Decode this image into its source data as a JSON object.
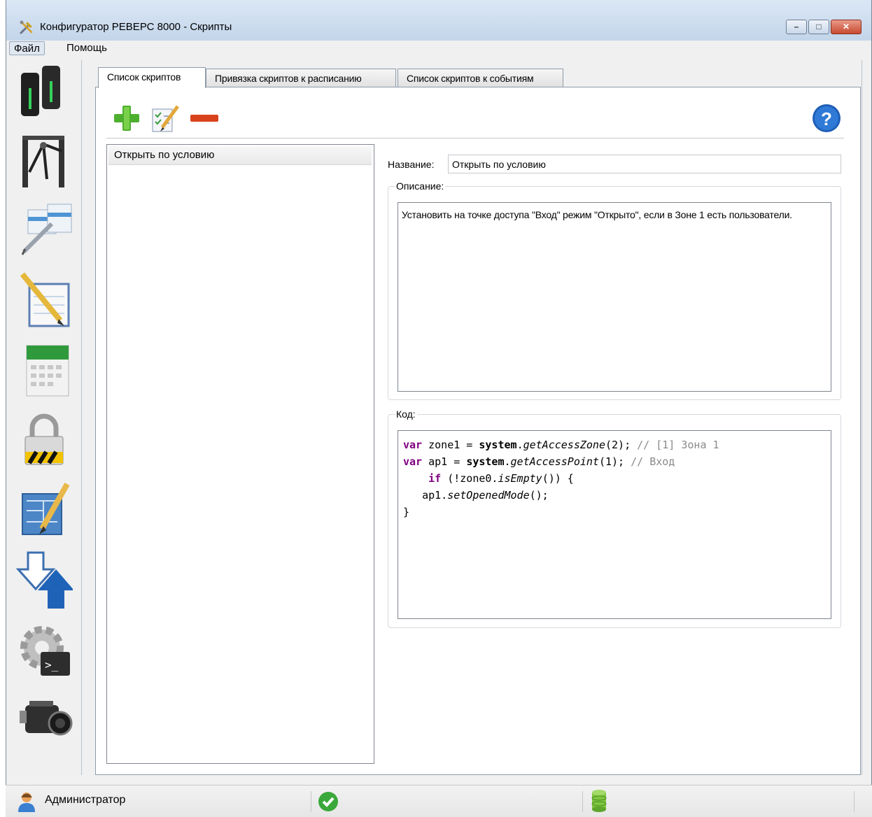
{
  "window": {
    "title": "Конфигуратор РЕВЕРС 8000 - Скрипты",
    "controls": {
      "minimize": "–",
      "maximize": "□",
      "close": "✕"
    }
  },
  "menu": {
    "items": [
      "Файл",
      "Помощь"
    ]
  },
  "sidebar": {
    "items": [
      "card-readers-icon",
      "turnstile-icon",
      "access-levels-icon",
      "notepad-icon",
      "calendar-icon",
      "padlock-icon",
      "map-editor-icon",
      "upload-download-icon",
      "script-gear-icon",
      "video-camera-icon"
    ]
  },
  "tabs": [
    "Список скриптов",
    "Привязка скриптов к расписанию",
    "Список скриптов к событиям"
  ],
  "toolbar": {
    "add": "plus-icon",
    "edit": "edit-checklist-icon",
    "remove": "minus-icon",
    "help": "?"
  },
  "scripts": {
    "items": [
      "Открыть по условию"
    ]
  },
  "form": {
    "name_label": "Название:",
    "name_value": "Открыть по условию",
    "description_label": "Описание:",
    "description_text": "Установить на точке доступа \"Вход\" режим \"Открыто\", если в Зоне 1 есть пользователи.",
    "code_label": "Код:"
  },
  "code": {
    "lines": [
      [
        {
          "t": "var",
          "c": "kw"
        },
        {
          "t": " zone1 = ",
          "c": ""
        },
        {
          "t": "system",
          "c": "sys"
        },
        {
          "t": ".",
          "c": ""
        },
        {
          "t": "getAccessZone",
          "c": "it"
        },
        {
          "t": "(2); ",
          "c": ""
        },
        {
          "t": "// [1] Зона 1",
          "c": "cm"
        }
      ],
      [
        {
          "t": "var",
          "c": "kw"
        },
        {
          "t": " ap1 = ",
          "c": ""
        },
        {
          "t": "system",
          "c": "sys"
        },
        {
          "t": ".",
          "c": ""
        },
        {
          "t": "getAccessPoint",
          "c": "it"
        },
        {
          "t": "(1); ",
          "c": ""
        },
        {
          "t": "// Вход",
          "c": "cm"
        }
      ],
      [
        {
          "t": "    ",
          "c": ""
        },
        {
          "t": "if",
          "c": "kw"
        },
        {
          "t": " (!zone0.",
          "c": ""
        },
        {
          "t": "isEmpty",
          "c": "it"
        },
        {
          "t": "()) {",
          "c": ""
        }
      ],
      [
        {
          "t": "   ap1.",
          "c": ""
        },
        {
          "t": "setOpenedMode",
          "c": "it"
        },
        {
          "t": "();",
          "c": ""
        }
      ],
      [
        {
          "t": "}",
          "c": ""
        }
      ]
    ]
  },
  "status": {
    "user": "Администратор",
    "connection": "ok-check-icon",
    "database": "database-icon"
  }
}
